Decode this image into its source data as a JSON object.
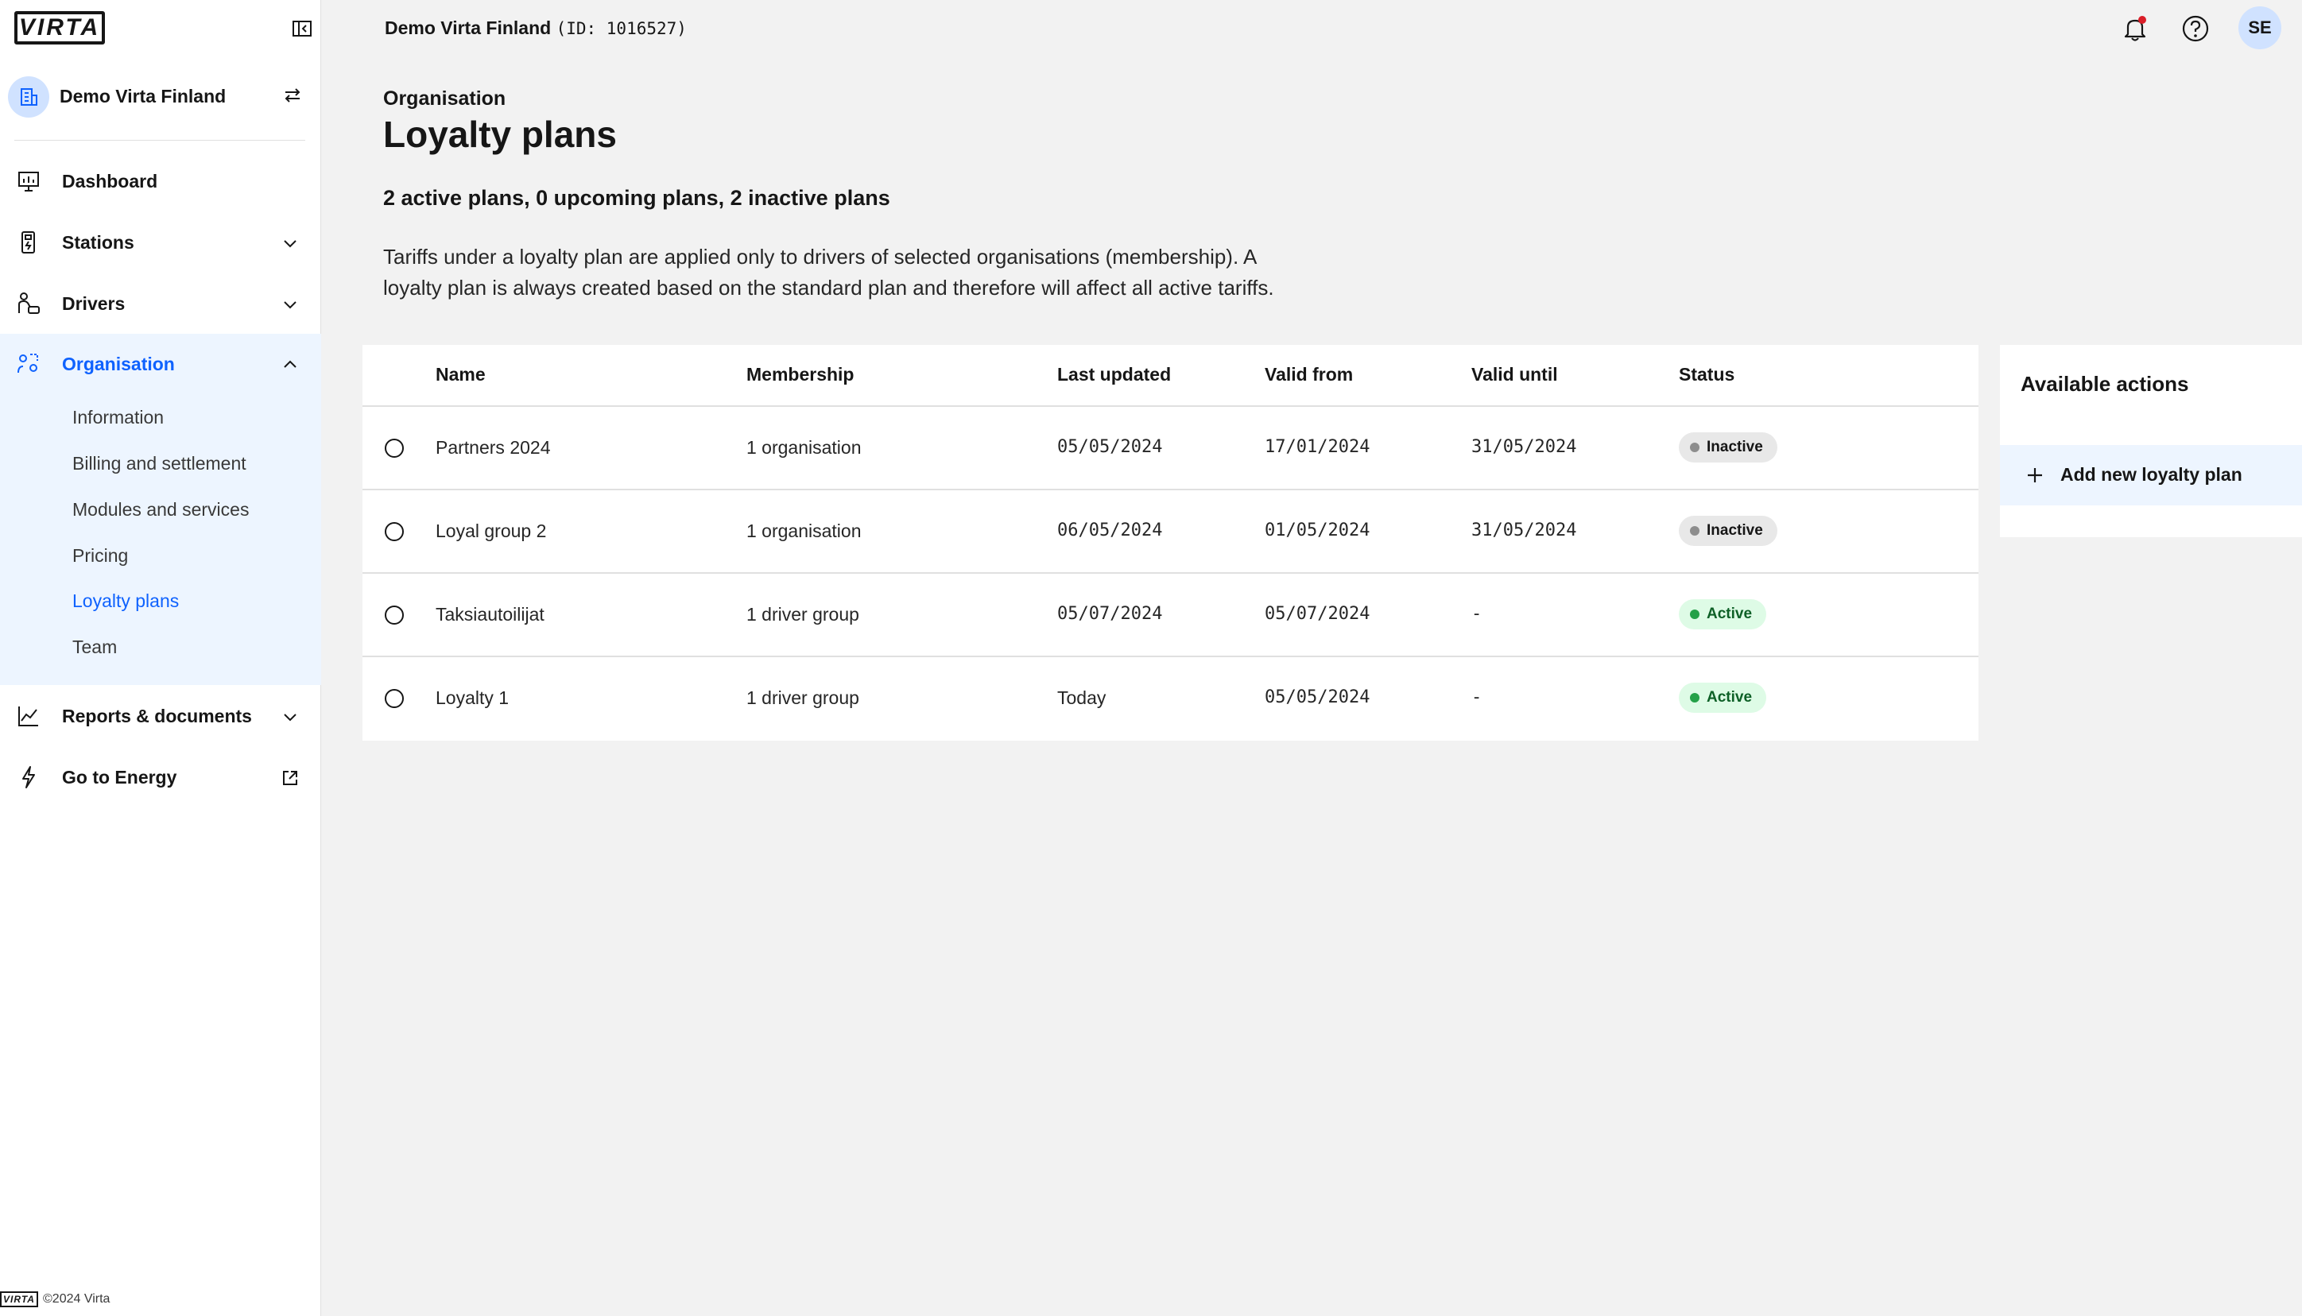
{
  "brand": {
    "logo_text": "VIRTA",
    "footer_text": "©2024 Virta",
    "accent": "#0f62fe"
  },
  "org_switcher": {
    "name": "Demo Virta Finland"
  },
  "nav": {
    "dashboard": "Dashboard",
    "stations": "Stations",
    "drivers": "Drivers",
    "organisation": "Organisation",
    "organisation_items": [
      "Information",
      "Billing and settlement",
      "Modules and services",
      "Pricing",
      "Loyalty plans",
      "Team"
    ],
    "reports": "Reports & documents",
    "energy": "Go to Energy"
  },
  "topbar": {
    "org_name": "Demo Virta Finland",
    "org_id": "(ID: 1016527)",
    "avatar_initials": "SE"
  },
  "page": {
    "eyebrow": "Organisation",
    "title": "Loyalty plans",
    "summary": "2 active plans, 0 upcoming plans, 2 inactive plans",
    "description": "Tariffs under a loyalty plan are applied only to drivers of selected organisations (membership). A loyalty plan is always created based on the standard plan and therefore will affect all active tariffs."
  },
  "table": {
    "headers": {
      "name": "Name",
      "membership": "Membership",
      "last_updated": "Last updated",
      "valid_from": "Valid from",
      "valid_until": "Valid until",
      "status": "Status"
    },
    "rows": [
      {
        "name": "Partners 2024",
        "membership": "1 organisation",
        "last_updated": "05/05/2024",
        "valid_from": "17/01/2024",
        "valid_until": "31/05/2024",
        "status": "Inactive"
      },
      {
        "name": "Loyal group 2",
        "membership": "1 organisation",
        "last_updated": "06/05/2024",
        "valid_from": "01/05/2024",
        "valid_until": "31/05/2024",
        "status": "Inactive"
      },
      {
        "name": "Taksiautoilijat",
        "membership": "1 driver group",
        "last_updated": "05/07/2024",
        "valid_from": "05/07/2024",
        "valid_until": "-",
        "status": "Active"
      },
      {
        "name": "Loyalty 1",
        "membership": "1 driver group",
        "last_updated": "Today",
        "valid_from": "05/05/2024",
        "valid_until": "-",
        "status": "Active"
      }
    ]
  },
  "actions": {
    "title": "Available actions",
    "add_label": "Add new loyalty plan"
  }
}
